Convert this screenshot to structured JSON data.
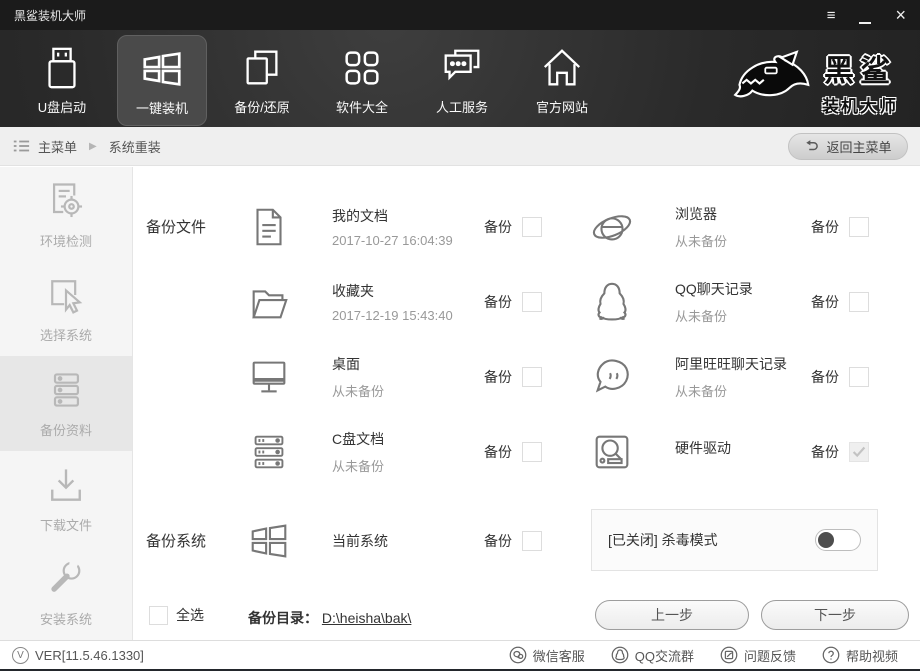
{
  "window": {
    "title": "黑鲨装机大师",
    "controls": {
      "menu_glyph": "≡",
      "close_glyph": "×"
    }
  },
  "nav": {
    "items": [
      {
        "label": "U盘启动",
        "icon": "usb-boot-icon",
        "active": false
      },
      {
        "label": "一键装机",
        "icon": "one-key-install-icon",
        "active": true
      },
      {
        "label": "备份/还原",
        "icon": "backup-restore-icon",
        "active": false
      },
      {
        "label": "软件大全",
        "icon": "software-collection-icon",
        "active": false
      },
      {
        "label": "人工服务",
        "icon": "customer-service-icon",
        "active": false
      },
      {
        "label": "官方网站",
        "icon": "official-website-icon",
        "active": false
      }
    ],
    "logo": {
      "icon": "shark-logo-icon",
      "line1": "黑鲨",
      "line2": "装机大师"
    }
  },
  "breadcrumb": {
    "menu_icon": "list-menu-icon",
    "root": "主菜单",
    "separator": "▶",
    "current": "系统重装",
    "back_button": {
      "icon": "return-arrow-icon",
      "label": "返回主菜单"
    }
  },
  "sidebar": {
    "items": [
      {
        "label": "环境检测",
        "icon": "environment-check-icon",
        "active": false
      },
      {
        "label": "选择系统",
        "icon": "select-system-icon",
        "active": false
      },
      {
        "label": "备份资料",
        "icon": "backup-data-icon",
        "active": true
      },
      {
        "label": "下载文件",
        "icon": "download-files-icon",
        "active": false
      },
      {
        "label": "安装系统",
        "icon": "install-system-icon",
        "active": false
      }
    ]
  },
  "main": {
    "section_files_label": "备份文件",
    "section_system_label": "备份系统",
    "backup_label": "备份",
    "file_items_left": [
      {
        "title": "我的文档",
        "subtitle": "2017-10-27 16:04:39",
        "icon": "document-icon",
        "checked": false
      },
      {
        "title": "收藏夹",
        "subtitle": "2017-12-19 15:43:40",
        "icon": "folder-icon",
        "checked": false
      },
      {
        "title": "桌面",
        "subtitle": "从未备份",
        "icon": "desktop-monitor-icon",
        "checked": false
      },
      {
        "title": "C盘文档",
        "subtitle": "从未备份",
        "icon": "c-drive-icon",
        "checked": false
      }
    ],
    "file_items_right": [
      {
        "title": "浏览器",
        "subtitle": "从未备份",
        "icon": "ie-browser-icon",
        "checked": false
      },
      {
        "title": "QQ聊天记录",
        "subtitle": "从未备份",
        "icon": "qq-penguin-icon",
        "checked": false
      },
      {
        "title": "阿里旺旺聊天记录",
        "subtitle": "从未备份",
        "icon": "aliwangwang-icon",
        "checked": false
      },
      {
        "title": "硬件驱动",
        "subtitle": "",
        "icon": "hardware-driver-icon",
        "checked": true,
        "disabled": true
      }
    ],
    "system_item": {
      "title": "当前系统",
      "icon": "windows-system-icon",
      "checked": false
    },
    "antivirus": {
      "label": "[已关闭] 杀毒模式",
      "enabled": false
    },
    "select_all_label": "全选",
    "backup_dir_label": "备份目录：",
    "backup_dir_path": "D:\\heisha\\bak\\",
    "prev_button": "上一步",
    "next_button": "下一步"
  },
  "footer": {
    "version_icon_glyph": "V",
    "version": "VER[11.5.46.1330]",
    "links": [
      {
        "label": "微信客服",
        "icon": "wechat-icon"
      },
      {
        "label": "QQ交流群",
        "icon": "qq-group-icon"
      },
      {
        "label": "问题反馈",
        "icon": "feedback-icon"
      },
      {
        "label": "帮助视频",
        "icon": "help-video-icon"
      }
    ]
  }
}
